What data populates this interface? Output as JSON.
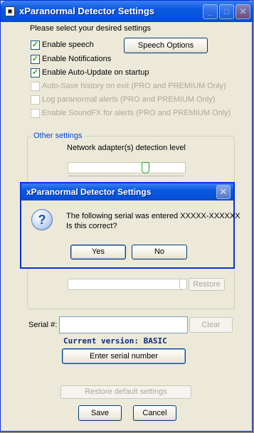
{
  "window": {
    "title": "xParanormal Detector Settings",
    "minimize": "_",
    "maximize": "□",
    "close": "✕"
  },
  "settings": {
    "intro": "Please select your desired settings",
    "options": [
      {
        "label": "Enable speech",
        "checked": true,
        "enabled": true
      },
      {
        "label": "Enable Notifications",
        "checked": true,
        "enabled": true
      },
      {
        "label": "Enable Auto-Update on startup",
        "checked": true,
        "enabled": true
      },
      {
        "label": "Auto-Save history on exit (PRO and PREMIUM Only)",
        "checked": false,
        "enabled": false
      },
      {
        "label": "Log paranormal alerts (PRO and PREMIUM Only)",
        "checked": false,
        "enabled": false
      },
      {
        "label": "Enable SoundFX for alerts (PRO and PREMIUM Only)",
        "checked": false,
        "enabled": false
      }
    ],
    "speech_options_label": "Speech Options"
  },
  "other": {
    "title": "Other settings",
    "network_label": "Network adapter(s) detection level",
    "restore_label": "Restore"
  },
  "serial": {
    "label": "Serial #:",
    "value": "",
    "clear_label": "Clear",
    "version_text": "Current version: BASIC",
    "enter_label": "Enter serial number"
  },
  "footer": {
    "restore_defaults_label": "Restore default settings",
    "save_label": "Save",
    "cancel_label": "Cancel"
  },
  "dialog": {
    "title": "xParanormal Detector Settings",
    "message_line1": "The following serial was entered XXXXX-XXXXXX",
    "message_line2": "Is this correct?",
    "yes_label": "Yes",
    "no_label": "No",
    "close": "✕"
  },
  "colors": {
    "accent": "#0831d9",
    "group_title": "#0046d5",
    "version_text": "#0a2a80"
  }
}
